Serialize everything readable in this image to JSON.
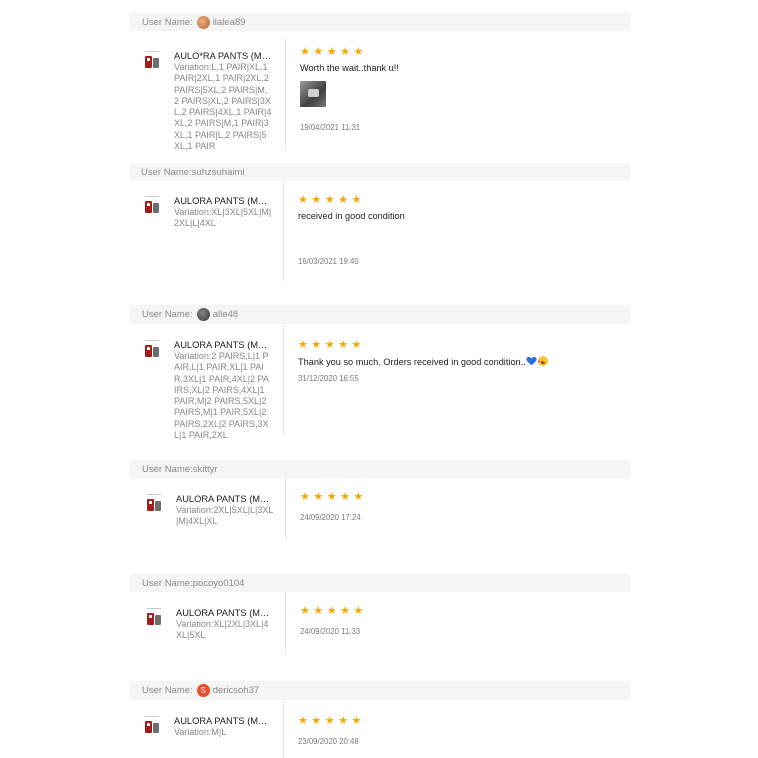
{
  "reviews": [
    {
      "user_label": "User Name:",
      "user": "ilalea89",
      "avatar": "photo-avatar",
      "product_name": "AULO*RA PANTS (ME...",
      "variation": "Variation:L,1 PAIR|XL,1 PAIR|2XL,1 PAIR|2XL,2 PAIRS|5XL,2 PAIRS|M,2 PAIRS|XL,2 PAIRS|3XL,2 PAIRS|4XL,1 PAIR|4XL,2 PAIRS|M,1 PAIR|3XL,1 PAIR|L,2 PAIRS|5XL,1 PAIR",
      "stars": 5,
      "comment": "Worth the wait..thank u!!",
      "has_photo": true,
      "date": "19/04/2021 11:31"
    },
    {
      "user_label": "User Name:",
      "user": "suhzsuhaimi",
      "avatar": "",
      "product_name": "AULORA PANTS (MEN...",
      "variation": "Variation:XL|3XL|5XL|M|2XL|L|4XL",
      "stars": 5,
      "comment": "received in good condition",
      "has_photo": false,
      "date": "16/03/2021 19:40"
    },
    {
      "user_label": "User Name:",
      "user": "alle48",
      "avatar": "photo-avatar",
      "product_name": "AULORA PANTS (MEN...",
      "variation": "Variation:2 PAIRS,L|1 PAIR,L|1 PAIR,XL|1 PAIR,3XL|1 PAIR,4XL|2 PAIRS,XL|2 PAIRS,4XL|1 PAIR,M|2 PAIRS,5XL|2 PAIRS,M|1 PAIR,5XL|2 PAIRS,2XL|2 PAIRS,3XL|1 PAIR,2XL",
      "stars": 5,
      "comment": "Thank you so much. Orders received in good condition..",
      "has_photo": false,
      "date": "31/12/2020 16:55"
    },
    {
      "user_label": "User Name:",
      "user": "skittyr",
      "avatar": "",
      "product_name": "AULORA PANTS (MEN...",
      "variation": "Variation:2XL|5XL|L|3XL|M|4XL|XL",
      "stars": 5,
      "comment": "",
      "has_photo": false,
      "date": "24/09/2020 17:24"
    },
    {
      "user_label": "User Name:",
      "user": "pocoyo0104",
      "avatar": "",
      "product_name": "AULORA PANTS (MEN,...",
      "variation": "Variation:XL|2XL|3XL|4XL|5XL",
      "stars": 5,
      "comment": "",
      "has_photo": false,
      "date": "24/09/2020 11:33"
    },
    {
      "user_label": "User Name:",
      "user": "dericsoh37",
      "avatar": "letter-avatar",
      "avatar_letter": "S",
      "product_name": "AULORA PANTS (MEN,...",
      "variation": "Variation:M|L",
      "stars": 5,
      "comment": "",
      "has_photo": false,
      "date": "23/09/2020 20:48"
    }
  ],
  "star_glyph": "★",
  "colors": {
    "star": "#f6a700",
    "accent": "#ee4d2d"
  }
}
